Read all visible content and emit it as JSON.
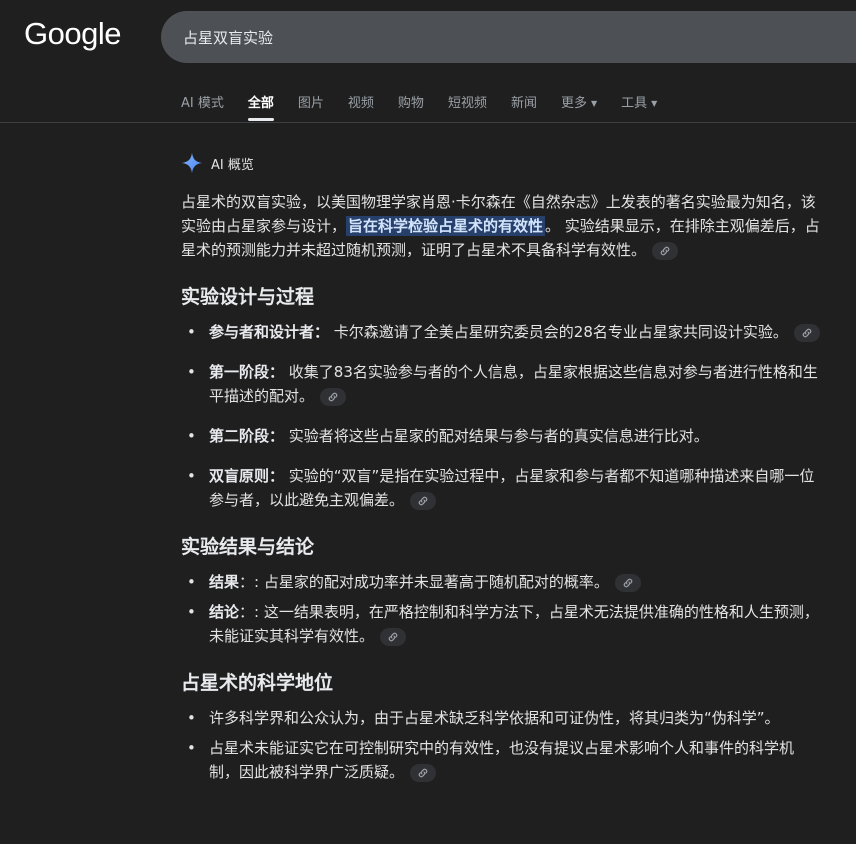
{
  "header": {
    "logo": "Google",
    "search_value": "占星双盲实验",
    "tabs": [
      {
        "label": "AI 模式"
      },
      {
        "label": "全部"
      },
      {
        "label": "图片"
      },
      {
        "label": "视频"
      },
      {
        "label": "购物"
      },
      {
        "label": "短视频"
      },
      {
        "label": "新闻"
      },
      {
        "label": "更多"
      },
      {
        "label": "工具"
      }
    ],
    "active_tab": "全部"
  },
  "overview": {
    "title": "AI 概览",
    "intro_a": "占星术的双盲实验，以美国物理学家肖恩·卡尔森在《自然杂志》上发表的著名实验最为知名，该实验由占星家参与设计，",
    "intro_highlight": "旨在科学检验占星术的有效性",
    "intro_b": "。 实验结果显示，在排除主观偏差后，占星术的预测能力并未超过随机预测，证明了占星术不具备科学有效性。"
  },
  "sections": [
    {
      "heading": "实验设计与过程",
      "items": [
        {
          "term": "参与者和设计者：",
          "text": " 卡尔森邀请了全美占星研究委员会的28名专业占星家共同设计实验。"
        },
        {
          "term": "第一阶段：",
          "text": " 收集了83名实验参与者的个人信息，占星家根据这些信息对参与者进行性格和生平描述的配对。"
        },
        {
          "term": "第二阶段：",
          "text": " 实验者将这些占星家的配对结果与参与者的真实信息进行比对。"
        },
        {
          "term": "双盲原则：",
          "text": " 实验的“双盲”是指在实验过程中，占星家和参与者都不知道哪种描述来自哪一位参与者，以此避免主观偏差。"
        }
      ]
    },
    {
      "heading": "实验结果与结论",
      "items": [
        {
          "term": "结果",
          "text": "：: 占星家的配对成功率并未显著高于随机配对的概率。"
        },
        {
          "term": "结论",
          "text": "：: 这一结果表明，在严格控制和科学方法下，占星术无法提供准确的性格和人生预测，未能证实其科学有效性。"
        }
      ]
    },
    {
      "heading": "占星术的科学地位",
      "items": [
        {
          "text": "许多科学界和公众认为，由于占星术缺乏科学依据和可证伪性，将其归类为“伪科学”。"
        },
        {
          "text": "占星术未能证实它在可控制研究中的有效性，也没有提议占星术影响个人和事件的科学机制，因此被科学界广泛质疑。"
        }
      ]
    }
  ],
  "colors": {
    "background": "#1f1f1f",
    "search_bg": "#4d5156",
    "highlight": "#27406b"
  },
  "icons": [
    "sparkle-icon",
    "link-icon",
    "caret-down-icon"
  ]
}
